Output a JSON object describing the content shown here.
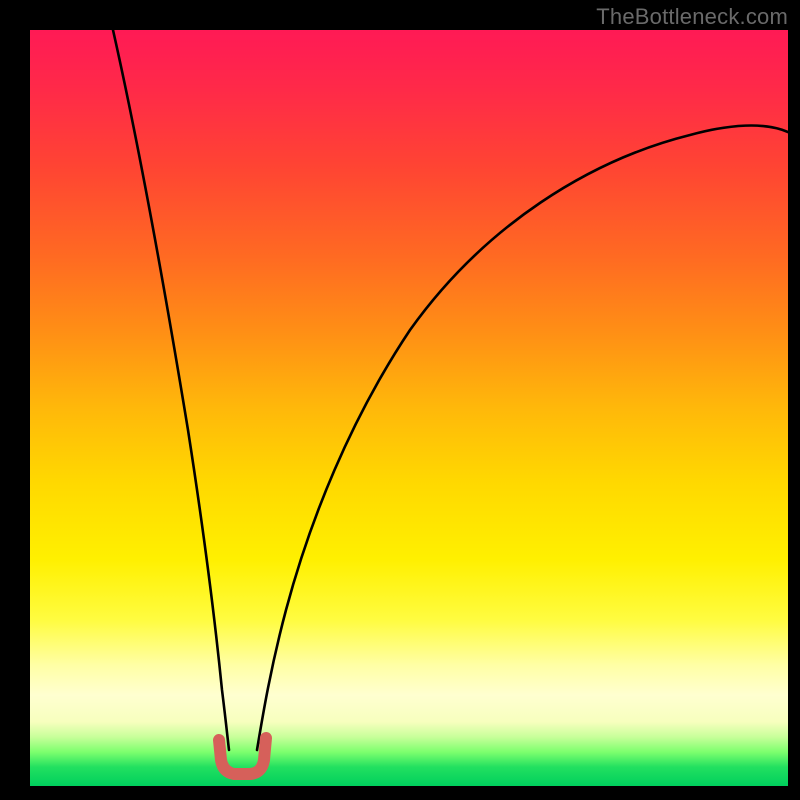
{
  "watermark": "TheBottleneck.com",
  "colors": {
    "black": "#000000",
    "curve_stroke": "#000000",
    "glyph_stroke": "#d6605a",
    "gradient_stops": [
      "#ff1a55",
      "#ff4433",
      "#ff8f15",
      "#ffd900",
      "#ffffa5",
      "#00cf5d"
    ]
  },
  "chart_data": {
    "type": "line",
    "title": "",
    "xlabel": "",
    "ylabel": "",
    "xlim": [
      0,
      100
    ],
    "ylim": [
      0,
      100
    ],
    "note": "No numeric axes, ticks, or labels are shown. Curve coordinates estimated in percent of plot area.",
    "series": [
      {
        "name": "left-curve",
        "x": [
          11.0,
          12.5,
          14.0,
          15.5,
          17.0,
          18.5,
          20.0,
          21.0,
          22.2,
          23.0,
          23.8,
          24.5,
          25.0,
          25.5,
          26.0,
          26.3
        ],
        "y": [
          100.0,
          89.0,
          78.0,
          68.0,
          58.0,
          48.0,
          39.0,
          32.0,
          25.0,
          20.0,
          15.5,
          11.5,
          9.0,
          7.0,
          5.5,
          4.8
        ]
      },
      {
        "name": "right-curve",
        "x": [
          30.0,
          31.0,
          32.5,
          34.5,
          37.0,
          41.0,
          46.0,
          52.0,
          59.0,
          66.0,
          74.0,
          82.0,
          90.0,
          96.0,
          100.0
        ],
        "y": [
          4.8,
          8.5,
          14.0,
          22.0,
          31.0,
          42.0,
          52.0,
          60.5,
          67.5,
          73.0,
          77.5,
          81.0,
          83.5,
          85.0,
          86.0
        ]
      },
      {
        "name": "u-glyph",
        "x": [
          25.0,
          25.2,
          25.7,
          26.5,
          27.5,
          28.7,
          29.7,
          30.4,
          30.9,
          31.1
        ],
        "y": [
          6.0,
          4.3,
          3.0,
          2.2,
          2.0,
          2.2,
          3.0,
          4.3,
          5.7,
          6.4
        ]
      }
    ]
  }
}
